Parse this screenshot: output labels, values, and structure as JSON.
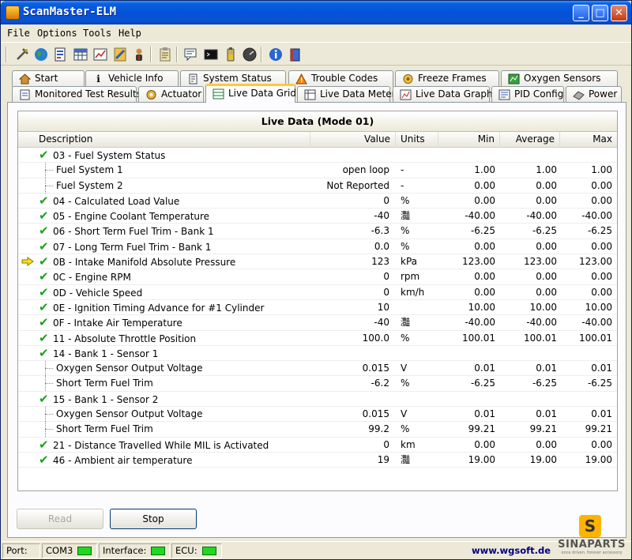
{
  "window": {
    "title": "ScanMaster-ELM"
  },
  "menu": [
    "File",
    "Options",
    "Tools",
    "Help"
  ],
  "toolbar": [
    "connect-icon",
    "globe-icon",
    "report-icon",
    "grid-icon",
    "chart-icon",
    "vehicle-icon",
    "person-icon",
    "clipboard-icon",
    "comment-icon",
    "terminal-icon",
    "battery-icon",
    "gauge-icon",
    "info-icon",
    "book-icon"
  ],
  "tabs_row1": [
    {
      "label": "Start",
      "icon": "home-icon"
    },
    {
      "label": "Vehicle Info",
      "icon": "info-icon"
    },
    {
      "label": "System Status",
      "icon": "document-icon"
    },
    {
      "label": "Trouble Codes",
      "icon": "warning-icon"
    },
    {
      "label": "Freeze Frames",
      "icon": "snowflake-icon"
    },
    {
      "label": "Oxygen Sensors",
      "icon": "sensor-icon"
    }
  ],
  "tabs_row2": [
    {
      "label": "Monitored Test Results",
      "icon": "test-icon"
    },
    {
      "label": "Actuator",
      "icon": "actuator-icon"
    },
    {
      "label": "Live Data Grid",
      "icon": "grid-icon",
      "active": true
    },
    {
      "label": "Live Data Meter",
      "icon": "meter-icon"
    },
    {
      "label": "Live Data Graph",
      "icon": "graph-icon"
    },
    {
      "label": "PID Config",
      "icon": "config-icon"
    },
    {
      "label": "Power",
      "icon": "power-icon"
    }
  ],
  "grid": {
    "title": "Live Data (Mode 01)",
    "headers": {
      "desc": "Description",
      "value": "Value",
      "units": "Units",
      "min": "Min",
      "avg": "Average",
      "max": "Max"
    },
    "rows": [
      {
        "type": "parent",
        "check": true,
        "desc": "03 - Fuel System Status",
        "value": "",
        "units": "",
        "min": "",
        "avg": "",
        "max": ""
      },
      {
        "type": "child",
        "desc": "Fuel System 1",
        "value": "open loop",
        "units": "-",
        "min": "1.00",
        "avg": "1.00",
        "max": "1.00"
      },
      {
        "type": "child",
        "desc": "Fuel System 2",
        "value": "Not Reported",
        "units": "-",
        "min": "0.00",
        "avg": "0.00",
        "max": "0.00"
      },
      {
        "type": "parent",
        "check": true,
        "desc": "04 - Calculated Load Value",
        "value": "0",
        "units": "%",
        "min": "0.00",
        "avg": "0.00",
        "max": "0.00"
      },
      {
        "type": "parent",
        "check": true,
        "desc": "05 - Engine Coolant Temperature",
        "value": "-40",
        "units": "灩",
        "min": "-40.00",
        "avg": "-40.00",
        "max": "-40.00"
      },
      {
        "type": "parent",
        "check": true,
        "desc": "06 - Short Term Fuel Trim - Bank 1",
        "value": "-6.3",
        "units": "%",
        "min": "-6.25",
        "avg": "-6.25",
        "max": "-6.25"
      },
      {
        "type": "parent",
        "check": true,
        "desc": "07 - Long Term Fuel Trim - Bank 1",
        "value": "0.0",
        "units": "%",
        "min": "0.00",
        "avg": "0.00",
        "max": "0.00"
      },
      {
        "type": "parent",
        "check": true,
        "arrow": true,
        "desc": "0B - Intake Manifold Absolute Pressure",
        "value": "123",
        "units": "kPa",
        "min": "123.00",
        "avg": "123.00",
        "max": "123.00"
      },
      {
        "type": "parent",
        "check": true,
        "desc": "0C - Engine RPM",
        "value": "0",
        "units": "rpm",
        "min": "0.00",
        "avg": "0.00",
        "max": "0.00"
      },
      {
        "type": "parent",
        "check": true,
        "desc": "0D - Vehicle Speed",
        "value": "0",
        "units": "km/h",
        "min": "0.00",
        "avg": "0.00",
        "max": "0.00"
      },
      {
        "type": "parent",
        "check": true,
        "desc": "0E - Ignition Timing Advance for #1 Cylinder",
        "value": "10",
        "units": "",
        "min": "10.00",
        "avg": "10.00",
        "max": "10.00"
      },
      {
        "type": "parent",
        "check": true,
        "desc": "0F - Intake Air Temperature",
        "value": "-40",
        "units": "灩",
        "min": "-40.00",
        "avg": "-40.00",
        "max": "-40.00"
      },
      {
        "type": "parent",
        "check": true,
        "desc": "11 - Absolute Throttle Position",
        "value": "100.0",
        "units": "%",
        "min": "100.01",
        "avg": "100.01",
        "max": "100.01"
      },
      {
        "type": "parent",
        "check": true,
        "desc": "14 - Bank 1 - Sensor 1",
        "value": "",
        "units": "",
        "min": "",
        "avg": "",
        "max": ""
      },
      {
        "type": "child",
        "desc": "Oxygen Sensor Output Voltage",
        "value": "0.015",
        "units": "V",
        "min": "0.01",
        "avg": "0.01",
        "max": "0.01"
      },
      {
        "type": "child",
        "desc": "Short Term Fuel Trim",
        "value": "-6.2",
        "units": "%",
        "min": "-6.25",
        "avg": "-6.25",
        "max": "-6.25"
      },
      {
        "type": "parent",
        "check": true,
        "desc": "15 - Bank 1 - Sensor 2",
        "value": "",
        "units": "",
        "min": "",
        "avg": "",
        "max": ""
      },
      {
        "type": "child",
        "desc": "Oxygen Sensor Output Voltage",
        "value": "0.015",
        "units": "V",
        "min": "0.01",
        "avg": "0.01",
        "max": "0.01"
      },
      {
        "type": "child",
        "desc": "Short Term Fuel Trim",
        "value": "99.2",
        "units": "%",
        "min": "99.21",
        "avg": "99.21",
        "max": "99.21"
      },
      {
        "type": "parent",
        "check": true,
        "desc": "21 - Distance Travelled While MIL is Activated",
        "value": "0",
        "units": "km",
        "min": "0.00",
        "avg": "0.00",
        "max": "0.00"
      },
      {
        "type": "parent",
        "check": true,
        "desc": "46 - Ambient air temperature",
        "value": "19",
        "units": "灩",
        "min": "19.00",
        "avg": "19.00",
        "max": "19.00"
      }
    ]
  },
  "buttons": {
    "read": "Read",
    "stop": "Stop"
  },
  "status": {
    "port_label": "Port:",
    "port_value": "COM3",
    "interface_label": "Interface:",
    "ecu_label": "ECU:",
    "website": "www.wgsoft.de"
  },
  "watermark": {
    "letter": "S",
    "name": "SINAPARTS",
    "tagline": "once driven. forever accessory"
  },
  "colors": {
    "titlebar": "#0452d8",
    "check": "#1ea11e",
    "led": "#1fd81f",
    "active_tab_accent": "#ffc83c"
  }
}
